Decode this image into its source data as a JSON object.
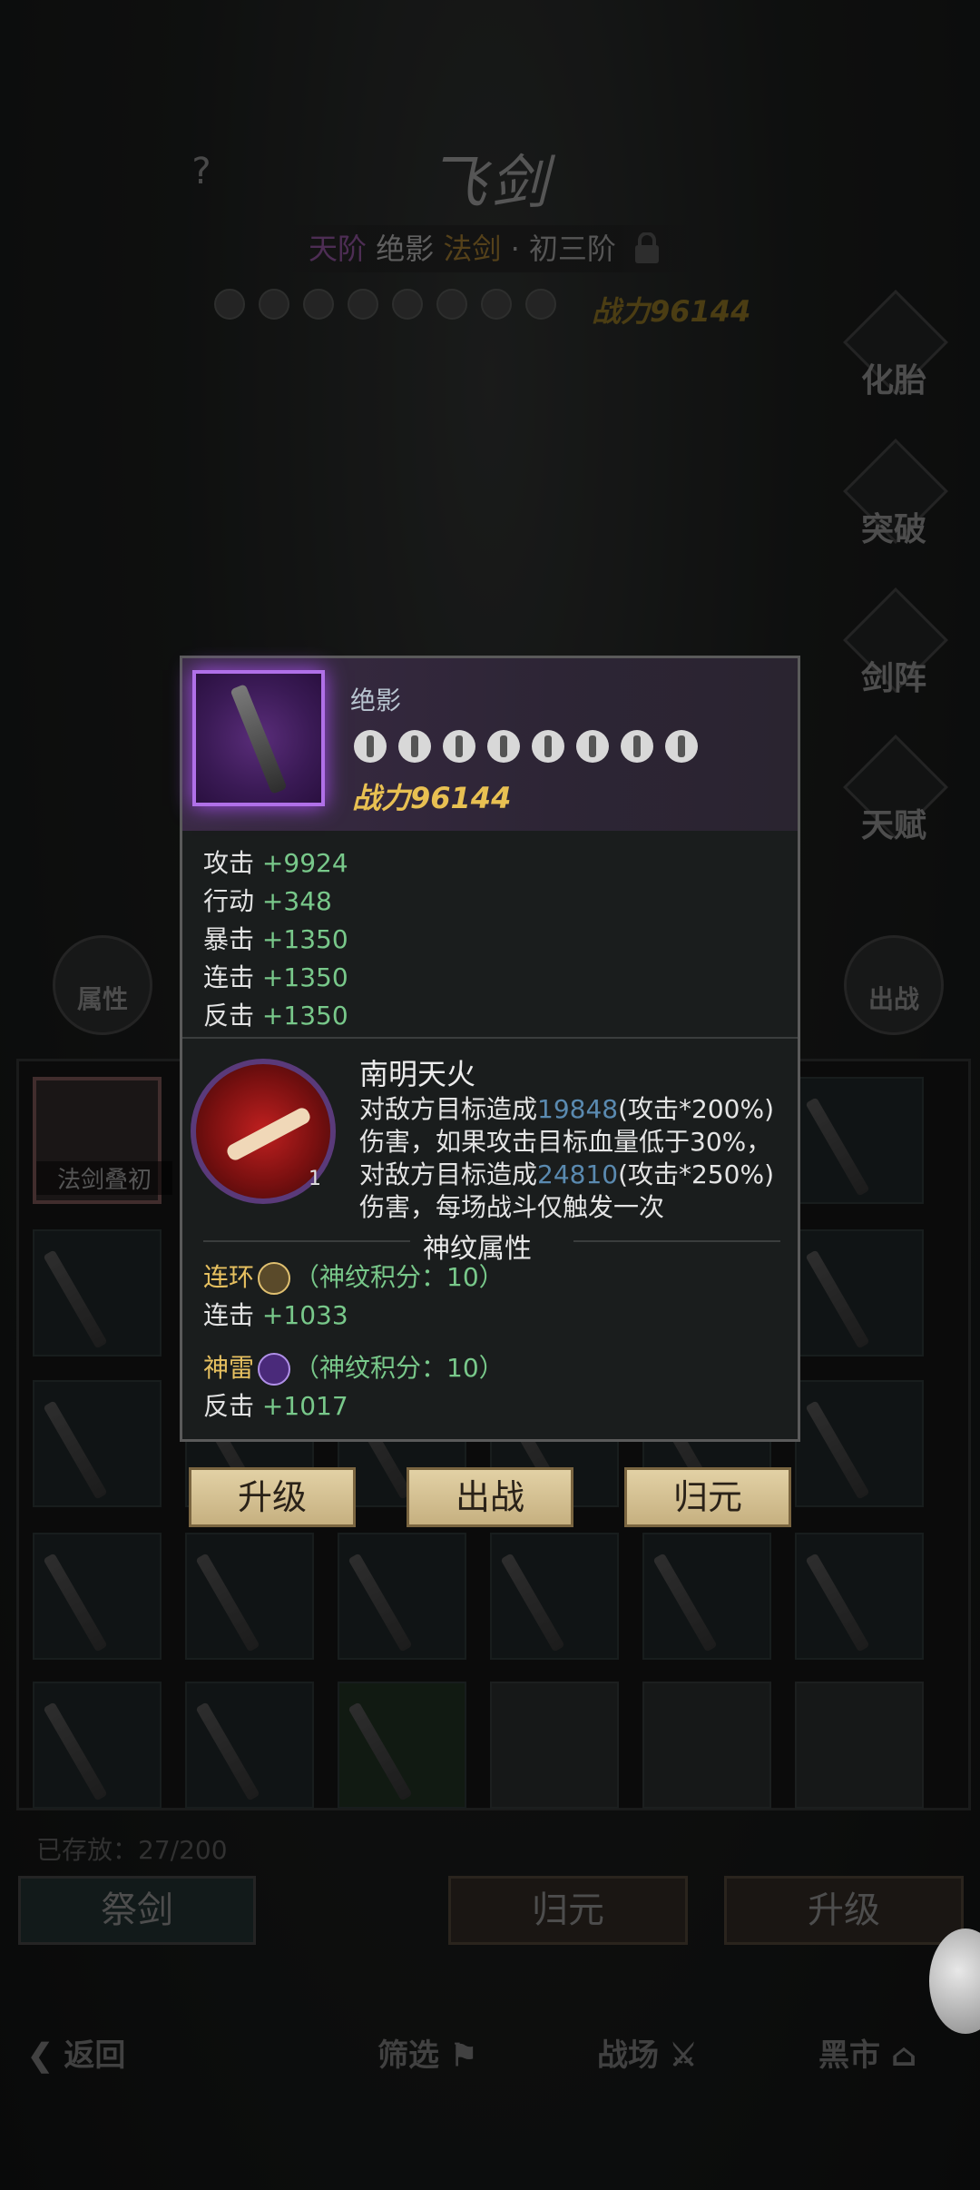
{
  "header": {
    "help": "?",
    "title": "飞剑",
    "grade": {
      "tier": "天阶",
      "name": "绝影",
      "type": "法剑",
      "sep": "·",
      "stage": "初三阶"
    },
    "power": "战力96144"
  },
  "side_menu": [
    "化胎",
    "突破",
    "剑阵",
    "天赋"
  ],
  "left_button": "属性",
  "right_button": "出战",
  "grid": {
    "selected_label": "法剑叠初",
    "cells": 40
  },
  "stored": "已存放：27/200",
  "bottom_buttons": {
    "sacrifice": "祭剑",
    "return_origin": "归元",
    "upgrade": "升级"
  },
  "bottom_nav": {
    "back": "返回",
    "filter": "筛选",
    "battlefield": "战场",
    "black_market": "黑市"
  },
  "popup": {
    "item_name": "绝影",
    "star_count": 8,
    "power": "战力96144",
    "stats": [
      {
        "name": "攻击",
        "value": "+9924"
      },
      {
        "name": "行动",
        "value": "+348"
      },
      {
        "name": "暴击",
        "value": "+1350"
      },
      {
        "name": "连击",
        "value": "+1350"
      },
      {
        "name": "反击",
        "value": "+1350"
      }
    ],
    "skill": {
      "name": "南明天火",
      "level": "1",
      "desc_1": "对敌方目标造成",
      "val_1": "19848",
      "desc_2": "(攻击*200%)伤害，如果攻击目标血量低于30%，对敌方目标造成",
      "val_2": "24810",
      "desc_3": "(攻击*250%)伤害，每场战斗仅触发一次"
    },
    "rune_title": "神纹属性",
    "runes": [
      {
        "name": "连环",
        "score": "（神纹积分：10）",
        "stat_name": "连击",
        "stat_value": "+1033"
      },
      {
        "name": "神雷",
        "score": "（神纹积分：10）",
        "stat_name": "反击",
        "stat_value": "+1017"
      }
    ],
    "actions": {
      "upgrade": "升级",
      "deploy": "出战",
      "return_origin": "归元"
    }
  },
  "colors": {
    "accent_gold": "#e8c052",
    "stat_green": "#78c88a",
    "highlight_blue": "#5a8ab0",
    "frame_purple": "#b070e8"
  }
}
